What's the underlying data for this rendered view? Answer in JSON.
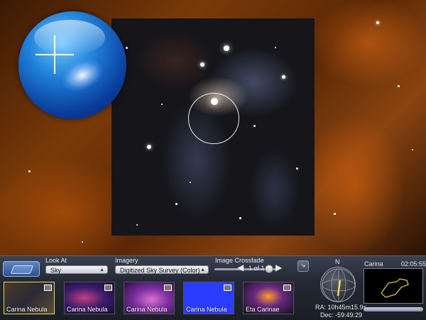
{
  "view": {
    "constellation": "Carina",
    "clock": "02:05:55"
  },
  "controls": {
    "look_at": {
      "label": "Look At",
      "value": "Sky"
    },
    "imagery": {
      "label": "Imagery",
      "value": "Digitized Sky Survey (Color)"
    },
    "crossfade": {
      "label": "Image Crossfade",
      "page": "1 of 1",
      "level": 0.8
    }
  },
  "compass": {
    "north": "N"
  },
  "coords": {
    "ra": "RA: 10h45m15.9s",
    "dec": "Dec: -59:49:29"
  },
  "thumbnails": [
    {
      "label": "Carina Nebula",
      "selected": true
    },
    {
      "label": "Carina Nebula",
      "selected": false
    },
    {
      "label": "Carina Nebula",
      "selected": false
    },
    {
      "label": "Carina Nebula",
      "selected": false
    },
    {
      "label": "Eta Carinae",
      "selected": false
    }
  ],
  "icons": [
    "mode-icon",
    "share-icon",
    "prev-arrow-icon",
    "next-arrow-icon",
    "image-badge-icon"
  ],
  "colors": {
    "selected_border": "#e6d84a",
    "minimap_outline": "#e6d84a",
    "accent_blue": "#2a3cff"
  }
}
